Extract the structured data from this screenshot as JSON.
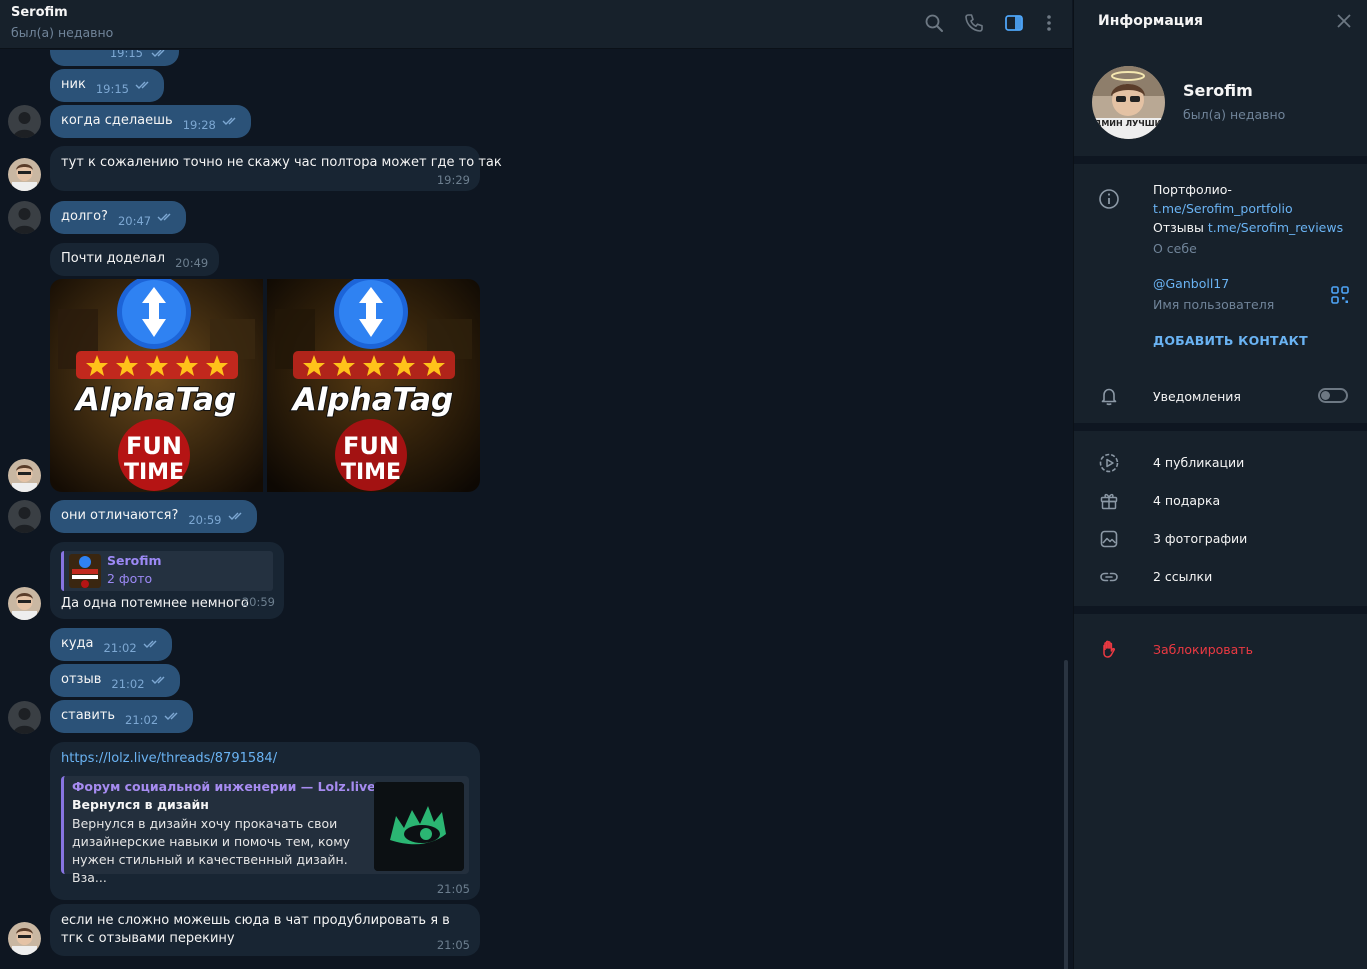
{
  "header": {
    "title": "Serofim",
    "status": "был(а) недавно"
  },
  "messages": [
    {
      "text": "",
      "time": "19:15",
      "dir": "out"
    },
    {
      "text": "ник",
      "time": "19:15",
      "dir": "out"
    },
    {
      "text": "когда сделаешь",
      "time": "19:28",
      "dir": "out"
    },
    {
      "text": "тут к сожалению  точно не скажу час полтора может где то так",
      "time": "19:29",
      "dir": "in"
    },
    {
      "text": "долго?",
      "time": "20:47",
      "dir": "out"
    },
    {
      "text": "Почти доделал",
      "time": "20:49",
      "dir": "in"
    },
    {
      "text": "они отличаются?",
      "time": "20:59",
      "dir": "out"
    },
    {
      "text": "Да одна потемнее немного",
      "time": "20:59",
      "dir": "in"
    },
    {
      "text": "куда",
      "time": "21:02",
      "dir": "out"
    },
    {
      "text": "отзыв",
      "time": "21:02",
      "dir": "out"
    },
    {
      "text": "ставить",
      "time": "21:02",
      "dir": "out"
    },
    {
      "text": "https://lolz.live/threads/8791584/",
      "time": "21:05",
      "dir": "in"
    },
    {
      "text": "если не сложно можешь сюда в чат продублировать я в тгк с отзывами перекину",
      "time": "21:05",
      "dir": "in"
    }
  ],
  "photos": {
    "brand": "AlphaTag",
    "line1": "FUN",
    "line2": "TIME"
  },
  "reply": {
    "name": "Serofim",
    "subtitle": "2 фото"
  },
  "link_preview": {
    "site": "Форум социальной инженерии — Lolz.live...",
    "title": "Вернулся в дизайн",
    "description": "Вернулся в дизайн хочу прокачать свои дизайнерские навыки и помочь тем, кому нужен стильный и качественный дизайн. Вза..."
  },
  "info_panel": {
    "title": "Информация",
    "name": "Serofim",
    "status": "был(а) недавно",
    "avatar_badge": "АДМИН ЛУЧШИЙ",
    "bio_line1": "Портфолио-",
    "bio_link1": "t.me/Serofim_portfolio",
    "bio_line3_prefix": "Отзывы ",
    "bio_link2": "t.me/Serofim_reviews",
    "bio_label": "О себе",
    "username": "@Ganboll17",
    "username_label": "Имя пользователя",
    "add_contact": "ДОБАВИТЬ КОНТАКТ",
    "notifications": "Уведомления",
    "notifications_on": false,
    "media": [
      {
        "label": "4 публикации",
        "icon": "stories-icon"
      },
      {
        "label": "4 подарка",
        "icon": "gift-icon"
      },
      {
        "label": "3 фотографии",
        "icon": "photo-icon"
      },
      {
        "label": "2 ссылки",
        "icon": "link-icon"
      }
    ],
    "block": "Заблокировать"
  },
  "colors": {
    "outgoing_bubble": "#2b5278",
    "incoming_bubble": "#182533",
    "background": "#0e1621",
    "panel": "#17212b",
    "accent": "#6ab3f3",
    "danger": "#ec3942"
  }
}
